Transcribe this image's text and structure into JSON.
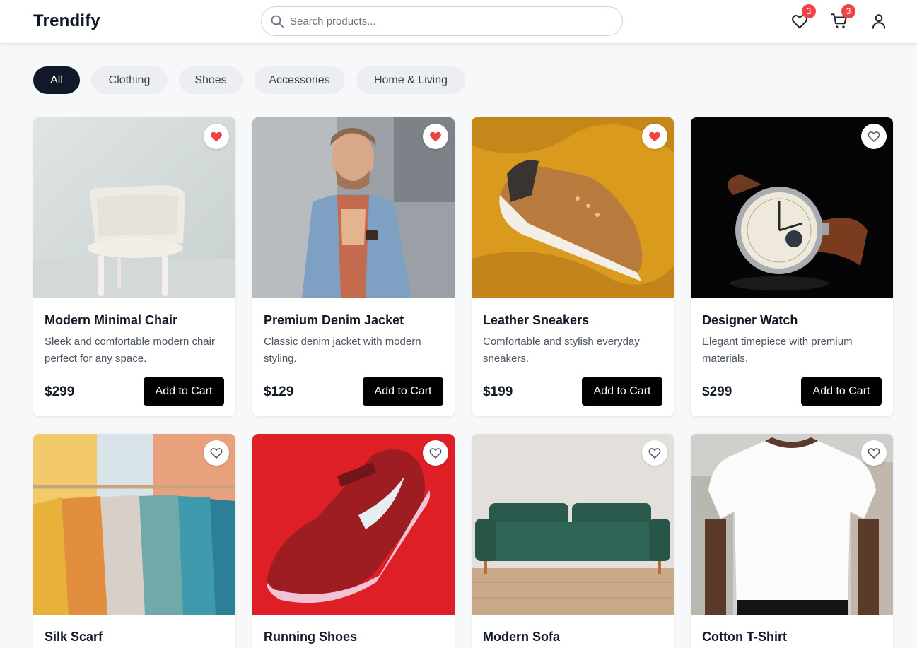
{
  "header": {
    "logo": "Trendify",
    "search_placeholder": "Search products...",
    "wishlist_count": "3",
    "cart_count": "3"
  },
  "categories": [
    "All",
    "Clothing",
    "Shoes",
    "Accessories",
    "Home & Living"
  ],
  "active_category": "All",
  "products": [
    {
      "title": "Modern Minimal Chair",
      "description": "Sleek and comfortable modern chair perfect for any space.",
      "price": "$299",
      "button": "Add to Cart",
      "favorited": true
    },
    {
      "title": "Premium Denim Jacket",
      "description": "Classic denim jacket with modern styling.",
      "price": "$129",
      "button": "Add to Cart",
      "favorited": true
    },
    {
      "title": "Leather Sneakers",
      "description": "Comfortable and stylish everyday sneakers.",
      "price": "$199",
      "button": "Add to Cart",
      "favorited": true
    },
    {
      "title": "Designer Watch",
      "description": "Elegant timepiece with premium materials.",
      "price": "$299",
      "button": "Add to Cart",
      "favorited": false
    },
    {
      "title": "Silk Scarf",
      "favorited": false
    },
    {
      "title": "Running Shoes",
      "favorited": false
    },
    {
      "title": "Modern Sofa",
      "favorited": false
    },
    {
      "title": "Cotton T-Shirt",
      "favorited": false
    }
  ],
  "colors": {
    "accent_dark": "#111827",
    "badge": "#ef4444",
    "heart_filled": "#ef4444"
  }
}
